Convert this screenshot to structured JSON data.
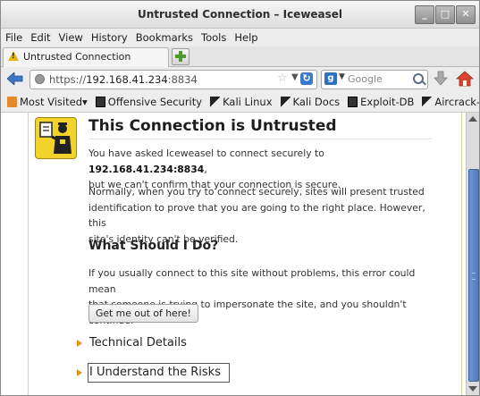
{
  "window": {
    "title": "Untrusted Connection – Iceweasel"
  },
  "menu": [
    "File",
    "Edit",
    "View",
    "History",
    "Bookmarks",
    "Tools",
    "Help"
  ],
  "tab": {
    "label": "Untrusted Connection"
  },
  "nav": {
    "url_prefix": "https://",
    "url_host": "192.168.41.234",
    "url_port": ":8834",
    "search_placeholder": "Google"
  },
  "bookmarks": [
    "Most Visited",
    "Offensive Security",
    "Kali Linux",
    "Kali Docs",
    "Exploit-DB",
    "Aircrack-ng"
  ],
  "page": {
    "title": "This Connection is Untrusted",
    "p1_a": "You have asked Iceweasel to connect securely to ",
    "p1_host": "192.168.41.234:8834",
    "p1_b": ",",
    "p1_c": "but we can't confirm that your connection is secure.",
    "p2_l1": "Normally, when you try to connect securely, sites will present trusted",
    "p2_l2": "identification to prove that you are going to the right place. However, this",
    "p2_l3": "site's identity can't be verified.",
    "heading2": "What Should I Do?",
    "p3_l1": "If you usually connect to this site without problems, this error could mean",
    "p3_l2": "that someone is trying to impersonate the site, and you shouldn't continue.",
    "button": "Get me out of here!",
    "technical": "Technical Details",
    "risks": "I Understand the Risks"
  }
}
